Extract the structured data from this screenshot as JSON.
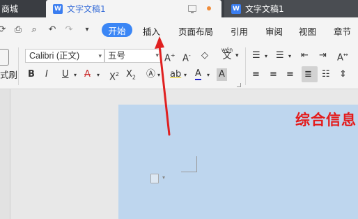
{
  "tabs": {
    "store": {
      "label": "商城"
    },
    "doc1": {
      "label": "文字文稿1",
      "icon": "W"
    },
    "doc2": {
      "label": "文字文稿1",
      "icon": "W"
    }
  },
  "menu": {
    "active": "开始",
    "items": [
      "插入",
      "页面布局",
      "引用",
      "审阅",
      "视图",
      "章节"
    ]
  },
  "ribbon": {
    "font_name": "Calibri (正文)",
    "font_size": "五号",
    "left_label": "式刷",
    "pinyin_label": "wén"
  },
  "watermark": "综合信息",
  "colors": {
    "active_tab": "#3b86f5",
    "page": "#bed6ee",
    "arrow": "#e02020",
    "watermark": "#e41b1b"
  }
}
